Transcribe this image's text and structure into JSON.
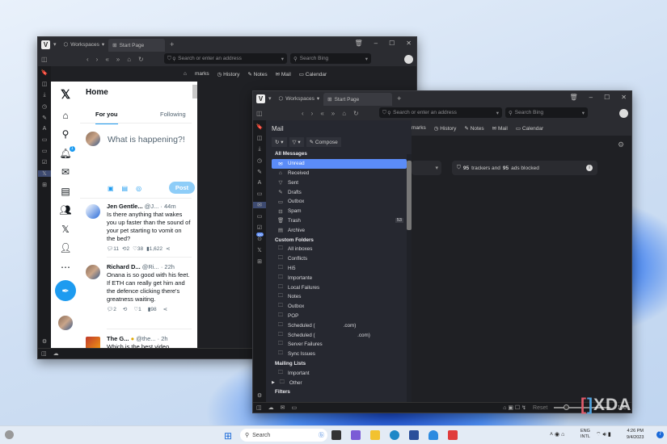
{
  "window_back": {
    "tabs": {
      "workspaces": "Workspaces",
      "start_page": "Start Page"
    },
    "address_placeholder": "Search or enter an address",
    "search_placeholder": "Search Bing",
    "bookmarks": [
      "marks",
      "History",
      "Notes",
      "Mail",
      "Calendar"
    ],
    "x_panel": {
      "title": "Home",
      "tab_for_you": "For you",
      "tab_following": "Following",
      "compose_placeholder": "What is happening?!",
      "post_label": "Post",
      "notification_count": "1",
      "tweets": [
        {
          "name": "Jen Gentle...",
          "handle": "@J...",
          "time": "· 44m",
          "text": "Is there anything that wakes you up faster than the sound of your pet starting to vomit on the bed?",
          "replies": "11",
          "retweets": "2",
          "likes": "38",
          "views": "1,622"
        },
        {
          "name": "Richard D...",
          "handle": "@Ri...",
          "time": "· 22h",
          "text": "Onana is so good with his feet. If ETH can really get him and the defence clicking there's greatness waiting.",
          "replies": "2",
          "retweets": "",
          "likes": "1",
          "views": "98"
        },
        {
          "name": "The G...",
          "handle": "@the...",
          "time": "· 2h",
          "text": "Which is the best video",
          "replies": "",
          "retweets": "",
          "likes": "",
          "views": ""
        }
      ]
    }
  },
  "window_front": {
    "tabs": {
      "workspaces": "Workspaces",
      "start_page": "Start Page"
    },
    "address_placeholder": "Search or enter an address",
    "search_placeholder": "Search Bing",
    "bookmarks": [
      "marks",
      "History",
      "Notes",
      "Mail",
      "Calendar"
    ],
    "tracker_text": {
      "count1": "95",
      "mid": "trackers and",
      "count2": "95",
      "end": "ads blocked"
    },
    "strip_badge": "100",
    "status": {
      "reset": "Reset",
      "zoom": "100"
    },
    "mail": {
      "title": "Mail",
      "compose": "Compose",
      "all_messages": "All Messages",
      "all_items": [
        {
          "label": "Unread",
          "icon": "✉"
        },
        {
          "label": "Received",
          "icon": "⌂"
        },
        {
          "label": "Sent",
          "icon": "▽"
        },
        {
          "label": "Drafts",
          "icon": "✎"
        },
        {
          "label": "Outbox",
          "icon": "▭"
        },
        {
          "label": "Spam",
          "icon": "⊟"
        },
        {
          "label": "Trash",
          "icon": "🗑",
          "count": "53"
        },
        {
          "label": "Archive",
          "icon": "▤"
        }
      ],
      "custom_folders": "Custom Folders",
      "custom_items": [
        "All inboxes",
        "Conflicts",
        "Hi5",
        "Importante",
        "Local Failures",
        "Notes",
        "Outbox",
        "POP",
        "Scheduled (                    .com)",
        "Scheduled (                              .com)",
        "Server Failures",
        "Sync Issues"
      ],
      "mailing_lists": "Mailing Lists",
      "mailing_items": [
        "Important",
        "Other"
      ],
      "filters": "Filters"
    }
  },
  "taskbar": {
    "search": "Search",
    "lang1": "ENG",
    "lang2": "INTL",
    "time": "4:26 PM",
    "date": "9/4/2023",
    "notif": "7"
  },
  "watermark": "XDA"
}
